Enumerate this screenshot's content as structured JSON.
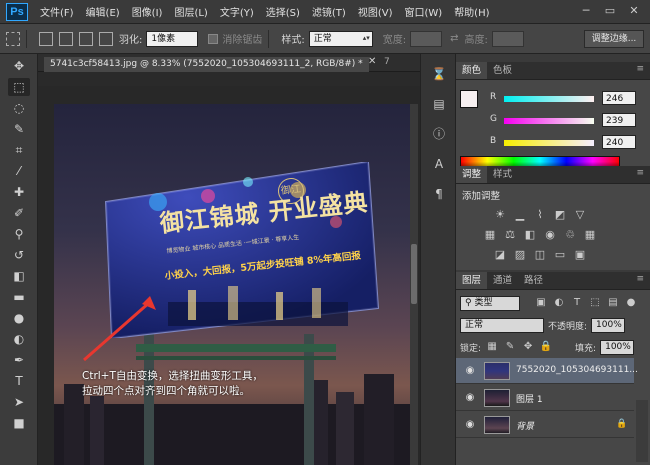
{
  "app": {
    "logo": "Ps"
  },
  "menu": [
    "文件(F)",
    "编辑(E)",
    "图像(I)",
    "图层(L)",
    "文字(Y)",
    "选择(S)",
    "滤镜(T)",
    "视图(V)",
    "窗口(W)",
    "帮助(H)"
  ],
  "window_controls": {
    "minimize": "─",
    "restore": "▭",
    "close": "✕"
  },
  "options": {
    "feather_label": "羽化:",
    "feather_value": "1像素",
    "antialias_label": "消除锯齿",
    "style_label": "样式:",
    "style_value": "正常",
    "width_label": "宽度:",
    "height_label": "高度:",
    "refine_edge": "调整边缘..."
  },
  "document": {
    "tab_label": "5741c3cf58413.jpg @ 8.33% (7552020_105304693111_2, RGB/8#) *",
    "tab_close": "✕",
    "next_tab": "7"
  },
  "billboard": {
    "title": "御江锦城 开业盛典",
    "small_text": "博览物业 城市核心 品质生活 ·一城江景 · 尊享人生",
    "promo": "小投入，大回报，5万起步投旺铺  8%年高回报",
    "logo": "御江"
  },
  "annotation": {
    "line1": "Ctrl+T自由变换，选择扭曲变形工具，",
    "line2": "拉动四个点对齐到四个角就可以啦。"
  },
  "color_panel": {
    "tabs": [
      "颜色",
      "色板"
    ],
    "r_label": "R",
    "r_value": "246",
    "g_label": "G",
    "g_value": "239",
    "b_label": "B",
    "b_value": "240",
    "fg_color": "#f6eff0"
  },
  "adjust_panel": {
    "tabs": [
      "调整",
      "样式"
    ],
    "title": "添加调整"
  },
  "layers_panel": {
    "tabs": [
      "图层",
      "通道",
      "路径"
    ],
    "filter_type": "类型",
    "blend_mode": "正常",
    "opacity_label": "不透明度:",
    "opacity_value": "100%",
    "lock_label": "锁定:",
    "fill_label": "填充:",
    "fill_value": "100%",
    "layers": [
      {
        "name": "7552020_105304693111..."
      },
      {
        "name": "图层 1"
      },
      {
        "name": "背景"
      }
    ]
  }
}
